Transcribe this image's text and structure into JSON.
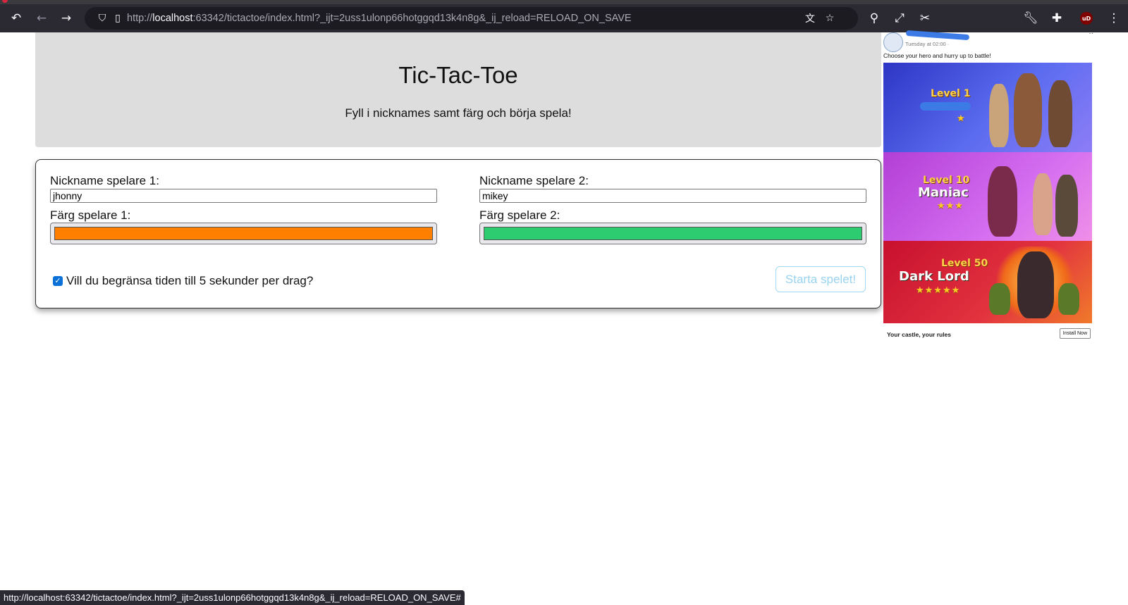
{
  "browser": {
    "url_host": "localhost",
    "url_rest": ":63342/tictactoe/index.html?_ijt=2uss1ulonp66hotggqd13k4n8g&_ij_reload=RELOAD_ON_SAVE",
    "url_prefix": "http://",
    "status_url": "http://localhost:63342/tictactoe/index.html?_ijt=2uss1ulonp66hotggqd13k4n8g&_ij_reload=RELOAD_ON_SAVE#",
    "ublock_label": "uD"
  },
  "header": {
    "title": "Tic-Tac-Toe",
    "subtitle": "Fyll i nicknames samt färg och börja spela!"
  },
  "form": {
    "player1": {
      "name_label": "Nickname spelare 1:",
      "name_value": "jhonny",
      "color_label": "Färg spelare 1:",
      "color_value": "#ff7f00"
    },
    "player2": {
      "name_label": "Nickname spelare 2:",
      "name_value": "mikey",
      "color_label": "Färg spelare 2:",
      "color_value": "#2ecc71"
    },
    "time_limit_label": "Vill du begränsa tiden till 5 sekunder per drag?",
    "time_limit_checked": true,
    "start_label": "Starta spelet!"
  },
  "ad": {
    "time": "Tuesday at 02:00 · ",
    "caption": "Choose your hero and hurry up to battle!",
    "levels": [
      {
        "title": "Level 1",
        "name": "",
        "stars": "★"
      },
      {
        "title": "Level 10",
        "name": "Maniac",
        "stars": "★★★"
      },
      {
        "title": "Level 50",
        "name": "Dark Lord",
        "stars": "★★★★★"
      }
    ],
    "footer": "Your castle, your rules",
    "install_label": "Install Now"
  }
}
